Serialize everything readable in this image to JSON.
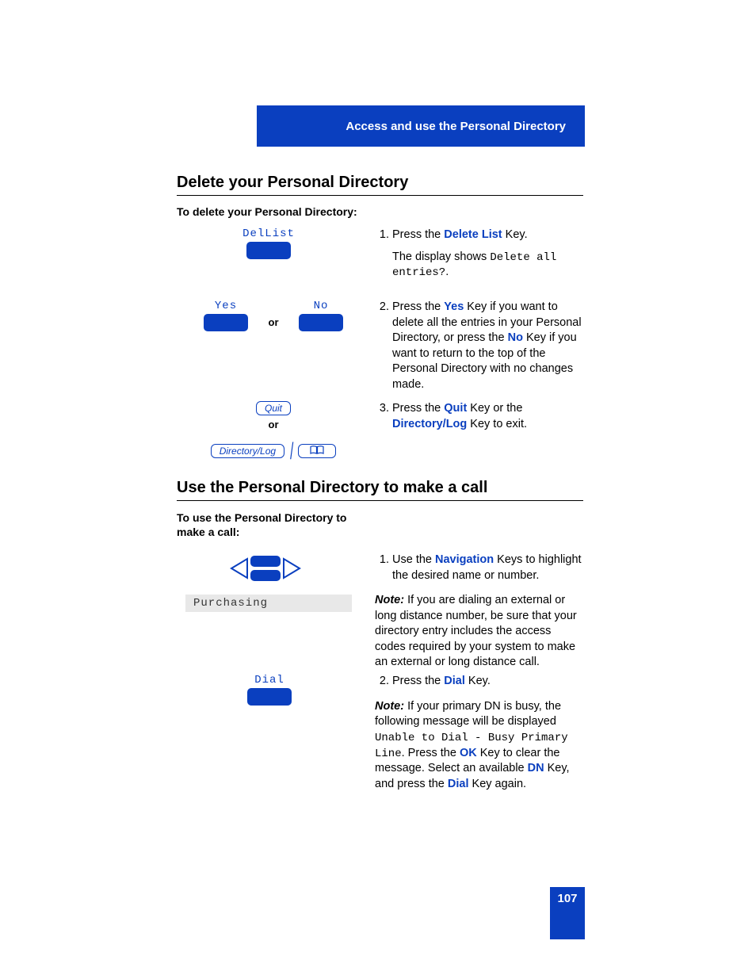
{
  "header": {
    "title": "Access and use the Personal Directory"
  },
  "section1": {
    "heading": "Delete your Personal Directory",
    "sub": "To delete your Personal Directory:",
    "keys": {
      "delList": "DelList",
      "yes": "Yes",
      "no": "No",
      "or": "or",
      "quit": "Quit",
      "dirLog": "Directory/Log"
    },
    "step1_a": "Press the ",
    "step1_kw": "Delete List",
    "step1_b": " Key.",
    "step1_disp_a": "The display shows ",
    "step1_disp_mono": "Delete all entries?",
    "step1_disp_b": ".",
    "step2_a": "Press the ",
    "step2_kw1": "Yes",
    "step2_b": " Key if you want to delete all the entries in your Personal Directory, or press the ",
    "step2_kw2": "No",
    "step2_c": " Key if you want to return to the top of the Personal Directory with no changes made.",
    "step3_a": "Press  the ",
    "step3_kw1": "Quit",
    "step3_b": " Key or the ",
    "step3_kw2": "Directory/Log",
    "step3_c": " Key to exit."
  },
  "section2": {
    "heading": "Use the Personal Directory to make a call",
    "sub": "To use the Personal Directory to make a call:",
    "display_entry": "Purchasing",
    "dial_label": "Dial",
    "step1_a": "Use the ",
    "step1_kw": "Navigation",
    "step1_b": " Keys to highlight the desired name or number.",
    "note1_label": "Note:",
    "note1_body": "  If you are dialing an external or long distance number, be sure that your directory entry includes the access codes required by your system to make an external or long distance call.",
    "step2_a": "Press the ",
    "step2_kw": "Dial",
    "step2_b": " Key.",
    "note2_label": "Note:",
    "note2_a": " If your primary DN is busy, the following message will be displayed ",
    "note2_mono": "Unable to Dial - Busy Primary Line",
    "note2_b": ". Press the ",
    "note2_kw1": "OK",
    "note2_c": " Key to clear the message. Select an available ",
    "note2_kw2": "DN",
    "note2_d": " Key, and press the ",
    "note2_kw3": "Dial",
    "note2_e": " Key again."
  },
  "page_number": "107"
}
